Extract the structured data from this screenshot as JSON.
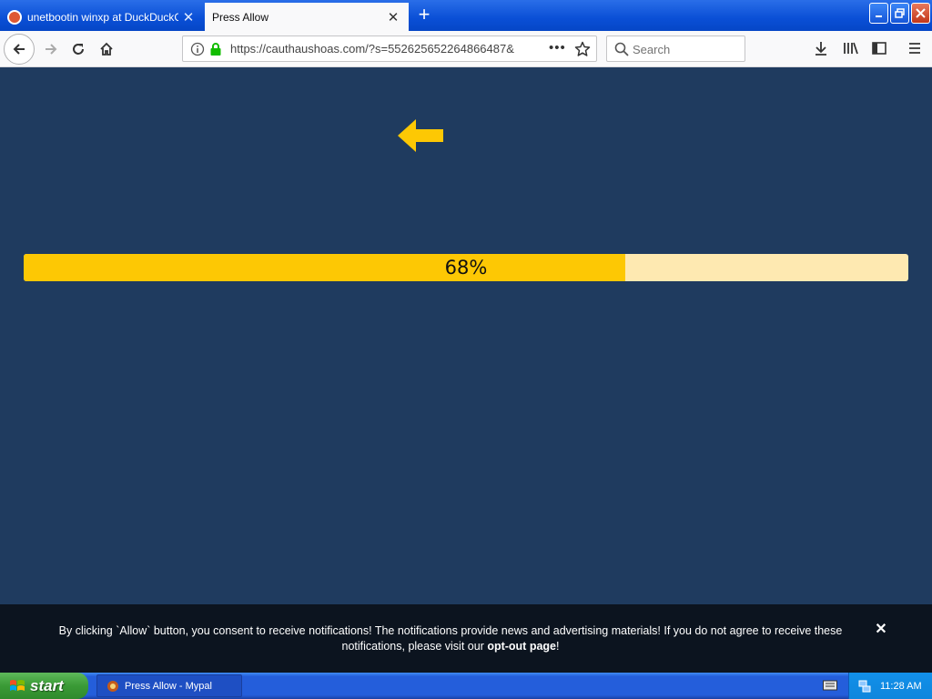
{
  "tabs": [
    {
      "label": "unetbootin winxp at DuckDuckGo",
      "active": false
    },
    {
      "label": "Press Allow",
      "active": true
    }
  ],
  "nav": {
    "url": "https://cauthaushoas.com/?s=552625652264866487&",
    "search_placeholder": "Search"
  },
  "page": {
    "progress_percent": 68,
    "progress_label": "68%",
    "accent_color": "#fdc804",
    "background_color": "#1f3b5f"
  },
  "notice": {
    "text_before": "By clicking `Allow` button, you consent to receive notifications! The notifications provide news and advertising materials! If you do not agree to receive these notifications, please visit our ",
    "link_text": "opt-out page",
    "text_after": "!",
    "close_symbol": "✕"
  },
  "taskbar": {
    "start_label": "start",
    "window_item": "Press Allow - Mypal",
    "clock": "11:28 AM"
  },
  "icons": {
    "tab_close": "✕",
    "new_tab": "+",
    "more": "•••",
    "minimize": "▁",
    "maximize": "❐",
    "close": "✕"
  }
}
